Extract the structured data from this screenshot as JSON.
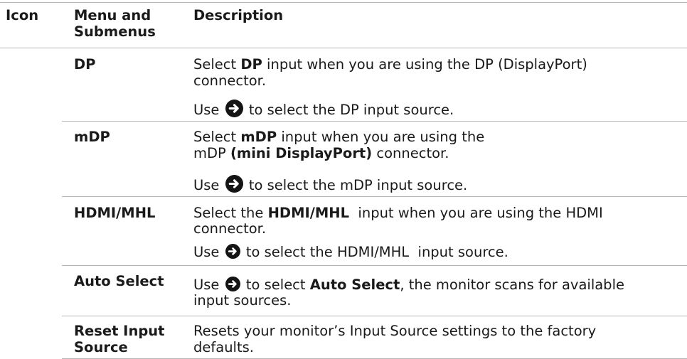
{
  "header": {
    "icon": "Icon",
    "menu_line1": "Menu and",
    "menu_line2": "Submenus",
    "description": "Description"
  },
  "rows": [
    {
      "menu": "DP",
      "p1_pre": "Select ",
      "p1_bold": "DP",
      "p1_post": " input when you are using the DP (DisplayPort)",
      "p1_line2": "connector.",
      "p2_pre": "Use",
      "p2_post": " to select the DP input source."
    },
    {
      "menu": "mDP",
      "p1_pre": "Select ",
      "p1_bold": "mDP",
      "p1_post": " input when you are using the",
      "p1_line2_pre": "mDP ",
      "p1_line2_bold": "(mini DisplayPort)",
      "p1_line2_post": " connector.",
      "p2_pre": "Use",
      "p2_post": " to select the mDP input source."
    },
    {
      "menu": "HDMI/MHL",
      "p1_pre": "Select the ",
      "p1_bold": "HDMI/MHL",
      "p1_post": "  input when you are using the HDMI",
      "p1_line2": "connector.",
      "p2_pre": "Use",
      "p2_post": " to select the HDMI/MHL  input source."
    },
    {
      "menu": "Auto Select",
      "p1_pre": "Use",
      "p1_mid": " to select ",
      "p1_bold": "Auto Select",
      "p1_post": ", the monitor scans for available",
      "p1_line2": "input sources."
    },
    {
      "menu_line1": "Reset Input",
      "menu_line2": "Source",
      "p1_line1": "Resets your monitor’s Input Source settings to the factory",
      "p1_line2": "defaults."
    }
  ],
  "icons": {
    "arrow": "right-arrow-circle-icon"
  }
}
